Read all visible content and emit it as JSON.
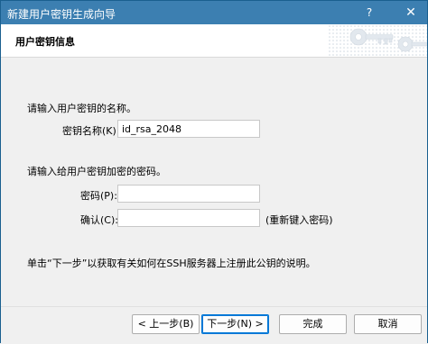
{
  "window": {
    "title": "新建用户密钥生成向导",
    "help_glyph": "?",
    "close_glyph": "✕",
    "help_icon": "question-icon",
    "close_icon": "close-icon"
  },
  "header": {
    "title": "用户密钥信息",
    "art_icon": "key-icon"
  },
  "content": {
    "prompt_name": "请输入用户密钥的名称。",
    "key_name_label": "密钥名称(K):",
    "key_name_value": "id_rsa_2048",
    "prompt_passphrase": "请输入给用户密钥加密的密码。",
    "password_label": "密码(P):",
    "password_value": "",
    "confirm_label": "确认(C):",
    "confirm_value": "",
    "reenter_hint": "(重新键入密码)",
    "info_text": "单击“下一步”以获取有关如何在SSH服务器上注册此公钥的说明。"
  },
  "buttons": {
    "back": "< 上一步(B)",
    "next": "下一步(N) >",
    "finish": "完成",
    "cancel": "取消"
  },
  "colors": {
    "titlebar": "#3c7fb1",
    "accent": "#0078d7"
  }
}
